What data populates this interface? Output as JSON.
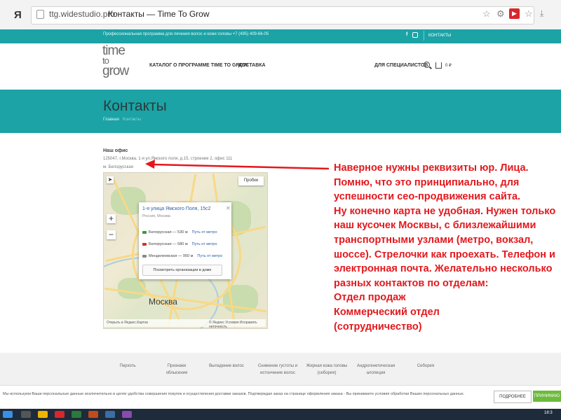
{
  "browser": {
    "logo": "Я",
    "url": "ttg.widestudio.pro",
    "page_title": "Контакты — Time To Grow"
  },
  "topbar": {
    "text": "Профессиональная программа для лечения волос и кожи головы +7 (495) 409-66-05",
    "contacts": "КОНТАКТЫ"
  },
  "header": {
    "logo_lines": [
      "time",
      "to",
      "grow"
    ],
    "nav": [
      "КАТАЛОГ",
      "О ПРОГРАММЕ TIME TO GROW",
      "ДОСТАВКА"
    ],
    "specialists": "ДЛЯ СПЕЦИАЛИСТОВ",
    "cart_price": "0 ₽"
  },
  "banner": {
    "title": "Контакты",
    "breadcrumb_home": "Главная",
    "breadcrumb_current": "Контакты"
  },
  "office": {
    "title": "Наш офис",
    "address": "125047, г.Москва, 1-я ул.Ямского поля, д.15, строение 2, офис 111",
    "metro": "м. Белорусская"
  },
  "map": {
    "traffic": "Пробки",
    "city": "Москва",
    "popup_title": "1-я улица Ямского Поля, 15с2",
    "popup_sub": "Россия, Москва",
    "stations": [
      {
        "name": "Белорусская",
        "dist": "— 530 м",
        "link": "Путь от метро",
        "color": "#3a9a3a"
      },
      {
        "name": "Белорусская",
        "dist": "— 580 м",
        "link": "Путь от метро",
        "color": "#c8362c"
      },
      {
        "name": "Менделеевская",
        "dist": "— 950 м",
        "link": "Путь от метро",
        "color": "#8a8a8a"
      }
    ],
    "org_button": "Посмотреть организации в доме",
    "footer_left": "Открыть в Яндекс.Картах",
    "footer_right": "© Яндекс  Условия  Исправить неточность"
  },
  "note": "Наверное нужны реквизиты юр. Лица. Помню, что это принципиально, для успешности сео-продвижения сайта.\nНу конечно карта не удобная. Нужен только наш кусочек Москвы, с близлежайшими транспортными узлами (метро, вокзал, шоссе). Стрелочки как проехать. Телефон и электронная почта. Желательно несколько разных контактов по отделам:\nОтдел продаж\nКоммерческий отдел\n(сотрудничество)",
  "footer": {
    "cols": [
      "Перхоть",
      "Признаки\nоблысения",
      "Выпадение волос",
      "Снижение густоты и\nистончение волос",
      "Жирная кожа головы\n(себорея)",
      "Андрогенетическая\nалопеция",
      "Себорея"
    ]
  },
  "cookie": {
    "text": "Мы используем Ваши персональные данные исключительно в целях удобства совершения покупок и осуществления доставки заказов. Подтверждая заказ на странице оформления заказа - Вы принимаете условия обработки Ваших персональных данных.",
    "more": "ПОДРОБНЕЕ",
    "accept": "ПРИНИМАЮ"
  },
  "taskbar": {
    "time": "18:3"
  }
}
